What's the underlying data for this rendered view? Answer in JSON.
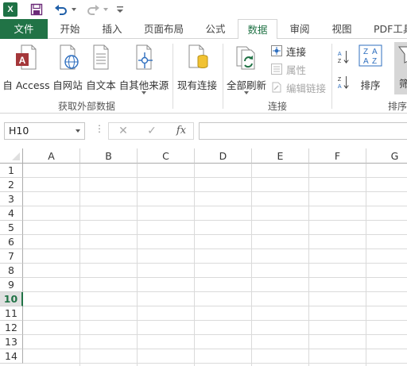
{
  "qat": {
    "app_logo": "X",
    "icons": [
      "excel-logo-icon",
      "save-icon",
      "undo-icon",
      "redo-icon",
      "customize-qat-icon"
    ]
  },
  "tabs": [
    {
      "label": "文件"
    },
    {
      "label": "开始"
    },
    {
      "label": "插入"
    },
    {
      "label": "页面布局"
    },
    {
      "label": "公式"
    },
    {
      "label": "数据"
    },
    {
      "label": "审阅"
    },
    {
      "label": "视图"
    },
    {
      "label": "PDF工具"
    }
  ],
  "ribbon": {
    "get_external": {
      "group_label": "获取外部数据",
      "buttons": [
        {
          "label": "自 Access"
        },
        {
          "label": "自网站"
        },
        {
          "label": "自文本"
        },
        {
          "label": "自其他来源"
        }
      ]
    },
    "existing_conn": {
      "label": "现有连接"
    },
    "connections": {
      "group_label": "连接",
      "refresh_all": "全部刷新",
      "connections_label": "连接",
      "properties_label": "属性",
      "edit_links_label": "编辑链接"
    },
    "sort_filter": {
      "group_label": "排序",
      "sort_label": "排序",
      "filter_label": "筛"
    }
  },
  "formula_bar": {
    "name_box": "H10",
    "fx": "fx",
    "cancel": "✕",
    "enter": "✓",
    "formula": ""
  },
  "grid": {
    "columns": [
      "A",
      "B",
      "C",
      "D",
      "E",
      "F",
      "G"
    ],
    "rows": [
      "1",
      "2",
      "3",
      "4",
      "5",
      "6",
      "7",
      "8",
      "9",
      "10",
      "11",
      "12",
      "13",
      "14"
    ],
    "selected_row": "10"
  },
  "colors": {
    "accent": "#217346",
    "access_red": "#a4373a"
  }
}
